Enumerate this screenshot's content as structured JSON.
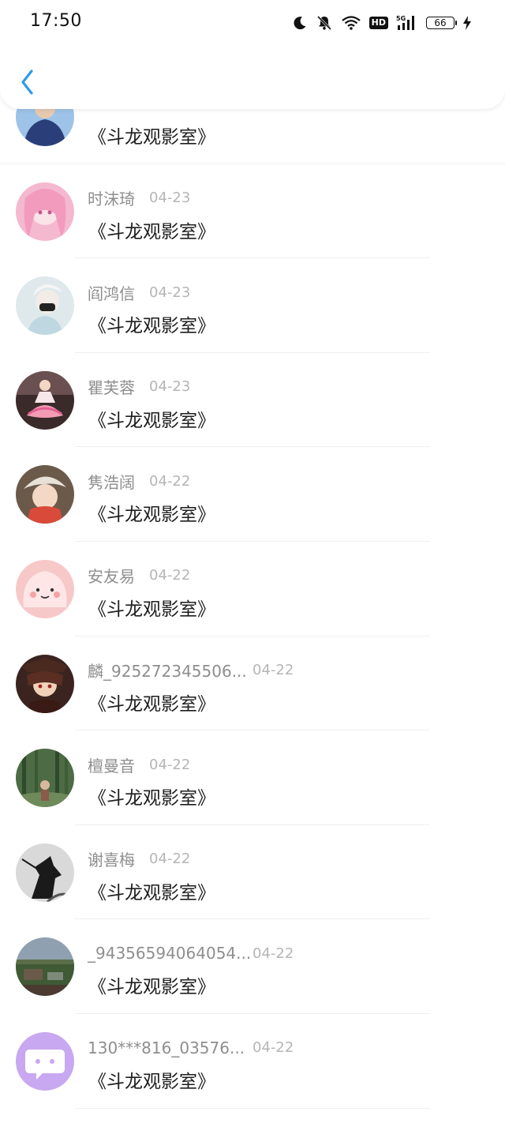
{
  "status_bar": {
    "time": "17:50",
    "battery": "66",
    "network": "5G",
    "hd": "HD"
  },
  "nav": {
    "back_icon": "chevron-left-icon",
    "accent": "#2b9ce6"
  },
  "comments": [
    {
      "name": "",
      "date": "",
      "message": "《斗龙观影室》",
      "avatar": {
        "bg": "#2a3f7a",
        "fg": "#e8c9b0",
        "kind": "boy-dark"
      }
    },
    {
      "name": "时沫琦",
      "date": "04-23",
      "message": "《斗龙观影室》",
      "avatar": {
        "bg": "#f4b8cf",
        "fg": "#fbe3ea",
        "kind": "anime-pink"
      }
    },
    {
      "name": "阎鸿信",
      "date": "04-23",
      "message": "《斗龙观影室》",
      "avatar": {
        "bg": "#dfe9ec",
        "fg": "#f5f5f5",
        "kind": "mask-boy"
      }
    },
    {
      "name": "瞿芙蓉",
      "date": "04-23",
      "message": "《斗龙观影室》",
      "avatar": {
        "bg": "#3a2a2a",
        "fg": "#f39bb5",
        "kind": "dress-girl"
      }
    },
    {
      "name": "隽浩阔",
      "date": "04-22",
      "message": "《斗龙观影室》",
      "avatar": {
        "bg": "#6b5a4a",
        "fg": "#d94a3a",
        "kind": "child-hat"
      }
    },
    {
      "name": "安友易",
      "date": "04-22",
      "message": "《斗龙观影室》",
      "avatar": {
        "bg": "#f7c8c8",
        "fg": "#ffe6e6",
        "kind": "pink-blob"
      }
    },
    {
      "name": "麟_925272345506...",
      "date": "04-22",
      "message": "《斗龙观影室》",
      "avatar": {
        "bg": "#3b2420",
        "fg": "#f0d2b8",
        "kind": "anime-girl"
      }
    },
    {
      "name": "檀曼音",
      "date": "04-22",
      "message": "《斗龙观影室》",
      "avatar": {
        "bg": "#4d6b45",
        "fg": "#c8d8c0",
        "kind": "forest"
      }
    },
    {
      "name": "谢喜梅",
      "date": "04-22",
      "message": "《斗龙观影室》",
      "avatar": {
        "bg": "#d9d9d9",
        "fg": "#1a1a1a",
        "kind": "ink-figure"
      }
    },
    {
      "name": "_94356594064054...",
      "date": "04-22",
      "message": "《斗龙观影室》",
      "avatar": {
        "bg": "#8fa0b0",
        "fg": "#3f5a35",
        "kind": "landscape"
      }
    },
    {
      "name": "130***816_03576...",
      "date": "04-22",
      "message": "《斗龙观影室》",
      "avatar": {
        "bg": "#c8a8f0",
        "fg": "#ffffff",
        "kind": "chat-bubble"
      }
    }
  ]
}
